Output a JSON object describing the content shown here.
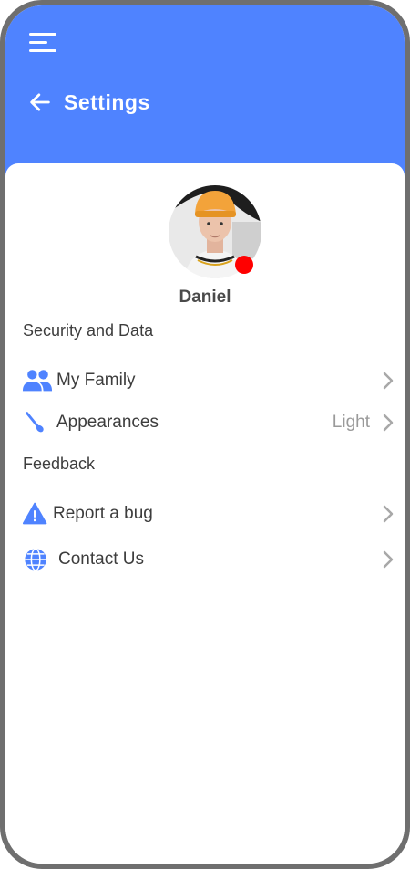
{
  "header": {
    "title": "Settings"
  },
  "profile": {
    "name": "Daniel"
  },
  "sections": {
    "security": {
      "title": "Security and Data"
    },
    "feedback": {
      "title": "Feedback"
    }
  },
  "items": {
    "family": {
      "label": "My Family",
      "icon": "people-icon"
    },
    "appearances": {
      "label": "Appearances",
      "value": "Light",
      "icon": "brush-icon"
    },
    "report": {
      "label": "Report a bug",
      "icon": "warning-icon"
    },
    "contact": {
      "label": "Contact Us",
      "icon": "globe-icon"
    }
  },
  "colors": {
    "accent": "#4f83ff",
    "status": "#ff0000",
    "chevron": "#a8a8a8"
  }
}
